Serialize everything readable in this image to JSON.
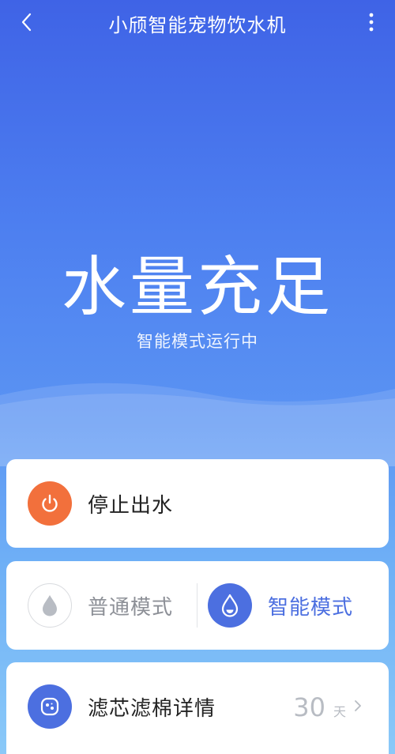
{
  "header": {
    "title": "小颀智能宠物饮水机"
  },
  "status": {
    "main": "水量充足",
    "sub": "智能模式运行中"
  },
  "stop_card": {
    "label": "停止出水",
    "icon": "power-icon",
    "accent": "#f2703c"
  },
  "mode_card": {
    "normal_label": "普通模式",
    "smart_label": "智能模式",
    "active": "smart",
    "active_color": "#4c6fe0",
    "inactive_color": "#8d9097"
  },
  "filter_card": {
    "label": "滤芯滤棉详情",
    "value": "30",
    "unit": "天",
    "icon": "filter-icon",
    "accent": "#4c6fe0"
  }
}
